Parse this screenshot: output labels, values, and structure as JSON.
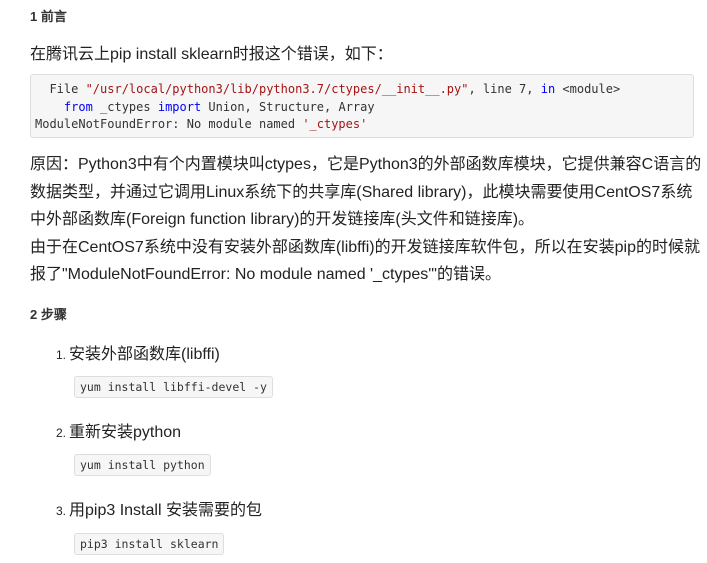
{
  "section1": {
    "title": "1 前言"
  },
  "intro": "在腾讯云上pip install sklearn时报这个错误，如下：",
  "error_block": {
    "line1_prefix": "  File ",
    "line1_path": "\"/usr/local/python3/lib/python3.7/ctypes/__init__.py\"",
    "line1_mid": ", line 7, ",
    "line1_in": "in",
    "line1_suffix": " <module>",
    "line2_indent": "    ",
    "line2_from": "from",
    "line2_mid": " _ctypes ",
    "line2_import": "import",
    "line2_suffix": " Union, Structure, Array",
    "line3_prefix": "ModuleNotFoundError: No module named ",
    "line3_str": "'_ctypes'"
  },
  "reason_para": "原因：Python3中有个内置模块叫ctypes，它是Python3的外部函数库模块，它提供兼容C语言的数据类型，并通过它调用Linux系统下的共享库(Shared library)，此模块需要使用CentOS7系统中外部函数库(Foreign function library)的开发链接库(头文件和链接库)。",
  "cause_para": "由于在CentOS7系统中没有安装外部函数库(libffi)的开发链接库软件包，所以在安装pip的时候就报了\"ModuleNotFoundError: No module named '_ctypes'\"的错误。",
  "section2": {
    "title": "2 步骤"
  },
  "steps": [
    {
      "num": "1.",
      "label": "安装外部函数库(libffi)",
      "command": "yum install libffi-devel -y"
    },
    {
      "num": "2.",
      "label": "重新安装python",
      "command": "yum install python"
    },
    {
      "num": "3.",
      "label": "用pip3 Install 安装需要的包",
      "command": "pip3 install sklearn"
    }
  ]
}
